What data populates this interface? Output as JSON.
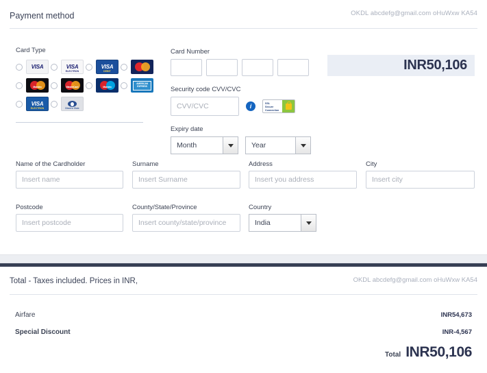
{
  "payment": {
    "title": "Payment method",
    "account_meta": "OKDL abcdefg@gmail.com oHuWxw KA54",
    "card_type": {
      "label": "Card Type",
      "options": [
        {
          "name": "visa",
          "text": "VISA",
          "sub": ""
        },
        {
          "name": "visa-electron",
          "text": "VISA",
          "sub": "ELECTRON"
        },
        {
          "name": "visa-debit",
          "text": "VISA",
          "sub": "DEBIT"
        },
        {
          "name": "mastercard",
          "text": "",
          "sub": ""
        },
        {
          "name": "maestro",
          "text": "",
          "sub": "Maestro"
        },
        {
          "name": "mastercard-debit",
          "text": "",
          "sub": "MasterCard"
        },
        {
          "name": "maestro-blue",
          "text": "Maestro",
          "sub": ""
        },
        {
          "name": "american-express",
          "text": "AMERICAN EXPRESS",
          "sub": ""
        },
        {
          "name": "visa-blue",
          "text": "VISA",
          "sub": "ELECTRON"
        },
        {
          "name": "diners-club",
          "text": "",
          "sub": "Diners Club"
        }
      ]
    },
    "card_number": {
      "label": "Card Number",
      "values": [
        "",
        "",
        "",
        ""
      ]
    },
    "security_code": {
      "label": "Security code CVV/CVC",
      "placeholder": "CVV/CVC",
      "value": "",
      "info_icon": "info-icon",
      "ssl_badge": {
        "line1": "SSL",
        "line2": "Secure",
        "line3": "Connection"
      }
    },
    "expiry": {
      "label": "Expiry date",
      "month_value": "Month",
      "year_value": "Year"
    },
    "amount": "INR50,106",
    "fields": {
      "cardholder": {
        "label": "Name of the Cardholder",
        "placeholder": "Insert name",
        "value": ""
      },
      "surname": {
        "label": "Surname",
        "placeholder": "Insert Surname",
        "value": ""
      },
      "address": {
        "label": "Address",
        "placeholder": "Insert you address",
        "value": ""
      },
      "city": {
        "label": "City",
        "placeholder": "Insert city",
        "value": ""
      },
      "postcode": {
        "label": "Postcode",
        "placeholder": "Insert postcode",
        "value": ""
      },
      "county": {
        "label": "County/State/Province",
        "placeholder": "Insert county/state/province",
        "value": ""
      },
      "country": {
        "label": "Country",
        "value": "India"
      }
    }
  },
  "totals": {
    "title": "Total - Taxes included. Prices in INR,",
    "account_meta": "OKDL abcdefg@gmail.com oHuWxw KA54",
    "items": [
      {
        "label": "Airfare",
        "amount": "INR54,673"
      },
      {
        "label": "Special Discount",
        "amount": "INR-4,567"
      }
    ],
    "grand_total_label": "Total",
    "grand_total_value": "INR50,106"
  },
  "colors": {
    "accent_dark": "#373f54",
    "amount_bg": "#eaeef5",
    "text": "#3c4354",
    "placeholder": "#a9aeb8"
  }
}
